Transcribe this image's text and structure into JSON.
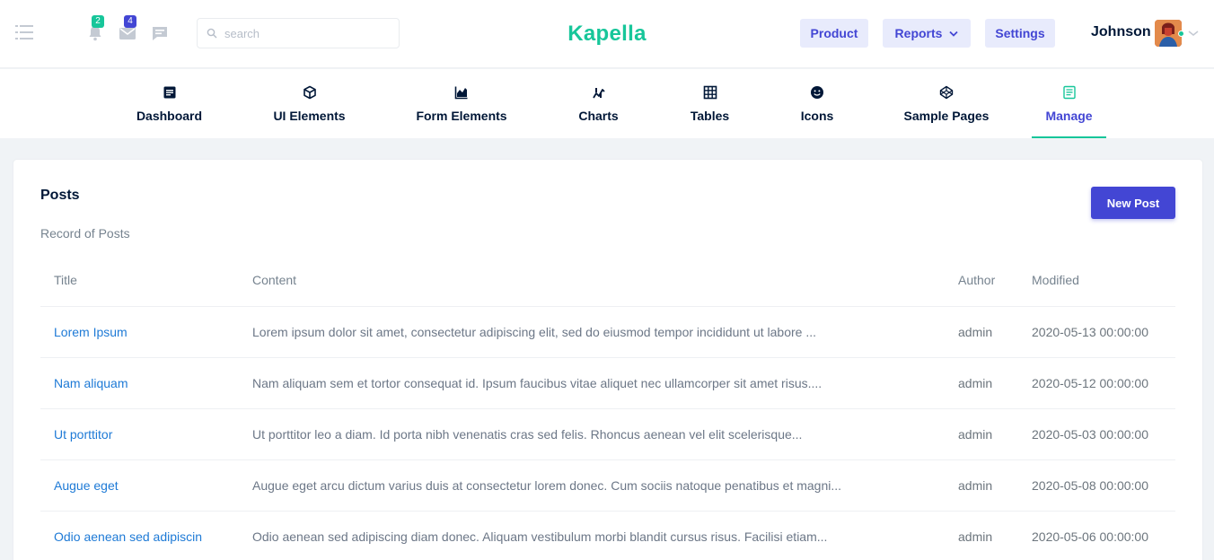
{
  "topbar": {
    "notifications_count": "2",
    "messages_count": "4",
    "search_placeholder": "search",
    "brand": "Kapella",
    "buttons": {
      "product": "Product",
      "reports": "Reports",
      "settings": "Settings"
    },
    "user_name": "Johnson"
  },
  "nav": {
    "items": [
      {
        "label": "Dashboard",
        "icon": "document-icon"
      },
      {
        "label": "UI Elements",
        "icon": "cube-icon"
      },
      {
        "label": "Form Elements",
        "icon": "area-chart-icon"
      },
      {
        "label": "Charts",
        "icon": "chart-icon"
      },
      {
        "label": "Tables",
        "icon": "grid-icon"
      },
      {
        "label": "Icons",
        "icon": "smiley-icon"
      },
      {
        "label": "Sample Pages",
        "icon": "codepen-icon"
      },
      {
        "label": "Manage",
        "icon": "notes-icon",
        "active": true
      }
    ]
  },
  "posts": {
    "title": "Posts",
    "subtitle": "Record of Posts",
    "new_button": "New Post",
    "columns": [
      "Title",
      "Content",
      "Author",
      "Modified"
    ],
    "rows": [
      {
        "title": "Lorem Ipsum",
        "content": "Lorem ipsum dolor sit amet, consectetur adipiscing elit, sed do eiusmod tempor incididunt ut labore ...",
        "author": "admin",
        "modified": "2020-05-13 00:00:00"
      },
      {
        "title": "Nam aliquam",
        "content": "Nam aliquam sem et tortor consequat id. Ipsum faucibus vitae aliquet nec ullamcorper sit amet risus....",
        "author": "admin",
        "modified": "2020-05-12 00:00:00"
      },
      {
        "title": "Ut porttitor",
        "content": "Ut porttitor leo a diam. Id porta nibh venenatis cras sed felis. Rhoncus aenean vel elit scelerisque...",
        "author": "admin",
        "modified": "2020-05-03 00:00:00"
      },
      {
        "title": "Augue eget",
        "content": "Augue eget arcu dictum varius duis at consectetur lorem donec. Cum sociis natoque penatibus et magni...",
        "author": "admin",
        "modified": "2020-05-08 00:00:00"
      },
      {
        "title": "Odio aenean sed adipiscin",
        "content": "Odio aenean sed adipiscing diam donec. Aliquam vestibulum morbi blandit cursus risus. Facilisi etiam...",
        "author": "admin",
        "modified": "2020-05-06 00:00:00"
      }
    ]
  },
  "colors": {
    "brand": "#17c69a",
    "accent": "#4346d4",
    "link": "#1e7ad6"
  }
}
